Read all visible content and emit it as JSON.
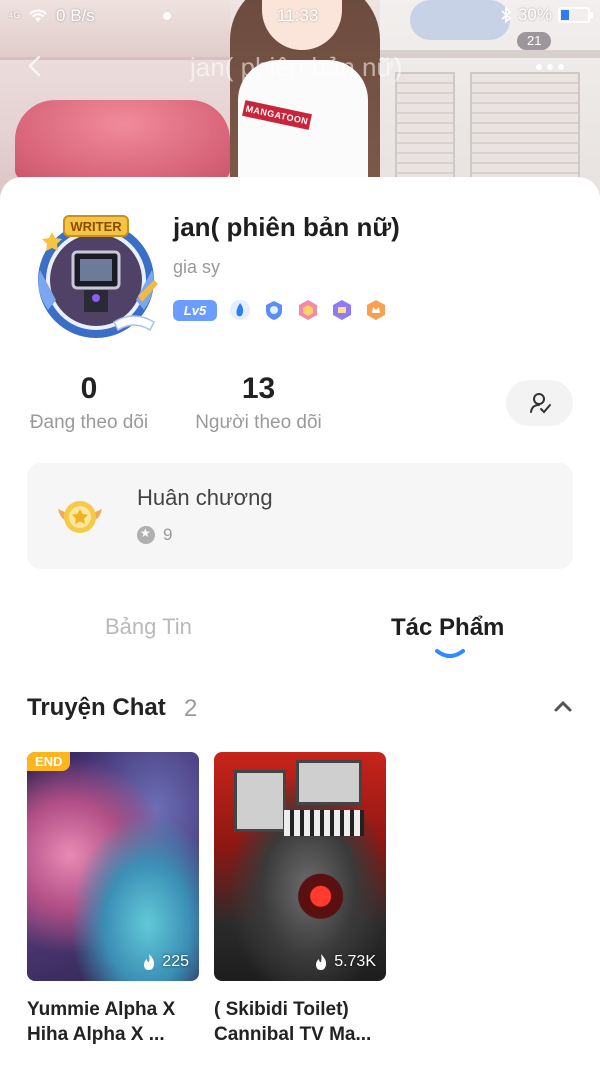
{
  "status_bar": {
    "signal": "⁴ᴳ",
    "network_speed": "0 B/s",
    "time": "11:33",
    "battery_percent": "30%",
    "battery_level": 0.3,
    "icons": [
      "signal-icon",
      "wifi-icon",
      "bluetooth-icon",
      "battery-icon"
    ]
  },
  "header": {
    "title": "jan( phiên bản nữ)",
    "notification_count": "21",
    "shirt_text": "MANGATOON"
  },
  "profile": {
    "name": "jan( phiên bản nữ)",
    "bio": "gia sy",
    "avatar_badge_text": "WRITER",
    "level": "Lv5",
    "badge_icons": [
      "flame-badge-icon",
      "shield-badge-icon",
      "hexagon-badge-icon",
      "gem-badge-icon",
      "crown-badge-icon"
    ]
  },
  "stats": {
    "following_count": "0",
    "following_label": "Đang theo dõi",
    "followers_count": "13",
    "followers_label": "Người theo dõi"
  },
  "medals": {
    "title": "Huân chương",
    "count": "9"
  },
  "tabs": [
    {
      "label": "Bảng Tin",
      "active": false
    },
    {
      "label": "Tác Phẩm",
      "active": true
    }
  ],
  "section": {
    "title": "Truyện Chat",
    "count": "2"
  },
  "works": [
    {
      "title": "Yummie Alpha X Hiha Alpha X ...",
      "tag": "END",
      "views": "225"
    },
    {
      "title": "( Skibidi Toilet) Cannibal TV Ma...",
      "tag": "",
      "views": "5.73K"
    }
  ],
  "colors": {
    "accent": "#2f8cff",
    "level_badge": "#6b9cff",
    "end_tag": "#ffb51e",
    "muted_text": "#9a9a9a"
  }
}
